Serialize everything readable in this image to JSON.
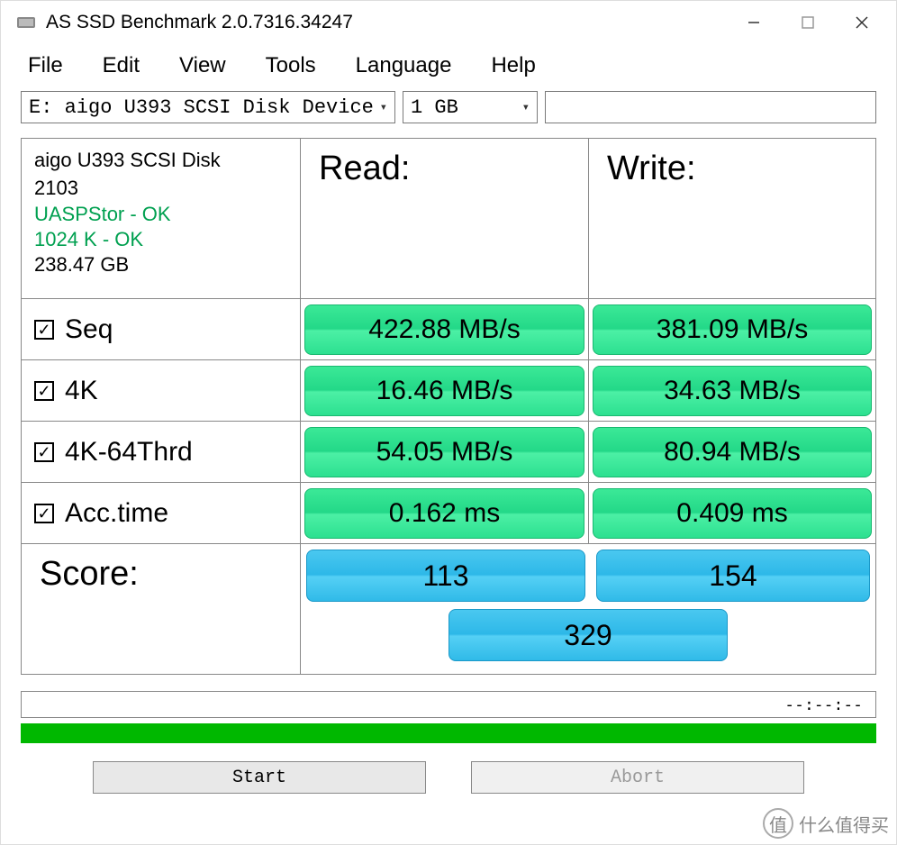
{
  "titlebar": {
    "title": "AS SSD Benchmark 2.0.7316.34247"
  },
  "menu": {
    "file": "File",
    "edit": "Edit",
    "view": "View",
    "tools": "Tools",
    "language": "Language",
    "help": "Help"
  },
  "controls": {
    "drive": "E: aigo U393 SCSI Disk Device",
    "size": "1 GB"
  },
  "device": {
    "name": "aigo U393 SCSI Disk",
    "firmware": "2103",
    "driver": "UASPStor - OK",
    "alignment": "1024 K - OK",
    "capacity": "238.47 GB"
  },
  "headers": {
    "read": "Read:",
    "write": "Write:",
    "score": "Score:"
  },
  "tests": {
    "seq": {
      "label": "Seq",
      "read": "422.88 MB/s",
      "write": "381.09 MB/s"
    },
    "k4": {
      "label": "4K",
      "read": "16.46 MB/s",
      "write": "34.63 MB/s"
    },
    "k4t": {
      "label": "4K-64Thrd",
      "read": "54.05 MB/s",
      "write": "80.94 MB/s"
    },
    "acc": {
      "label": "Acc.time",
      "read": "0.162 ms",
      "write": "0.409 ms"
    }
  },
  "scores": {
    "read": "113",
    "write": "154",
    "total": "329"
  },
  "progress": {
    "time": "--:--:--"
  },
  "buttons": {
    "start": "Start",
    "abort": "Abort"
  },
  "watermark": {
    "text": "什么值得买",
    "icon": "值"
  },
  "checkmark": "✓",
  "chart_data": {
    "type": "table",
    "title": "AS SSD Benchmark Results - aigo U393 SCSI Disk",
    "device": "aigo U393 SCSI Disk 2103",
    "capacity_gb": 238.47,
    "test_size": "1 GB",
    "rows": [
      {
        "test": "Seq",
        "read_mbs": 422.88,
        "write_mbs": 381.09
      },
      {
        "test": "4K",
        "read_mbs": 16.46,
        "write_mbs": 34.63
      },
      {
        "test": "4K-64Thrd",
        "read_mbs": 54.05,
        "write_mbs": 80.94
      },
      {
        "test": "Acc.time",
        "read_ms": 0.162,
        "write_ms": 0.409
      }
    ],
    "scores": {
      "read": 113,
      "write": 154,
      "total": 329
    }
  }
}
